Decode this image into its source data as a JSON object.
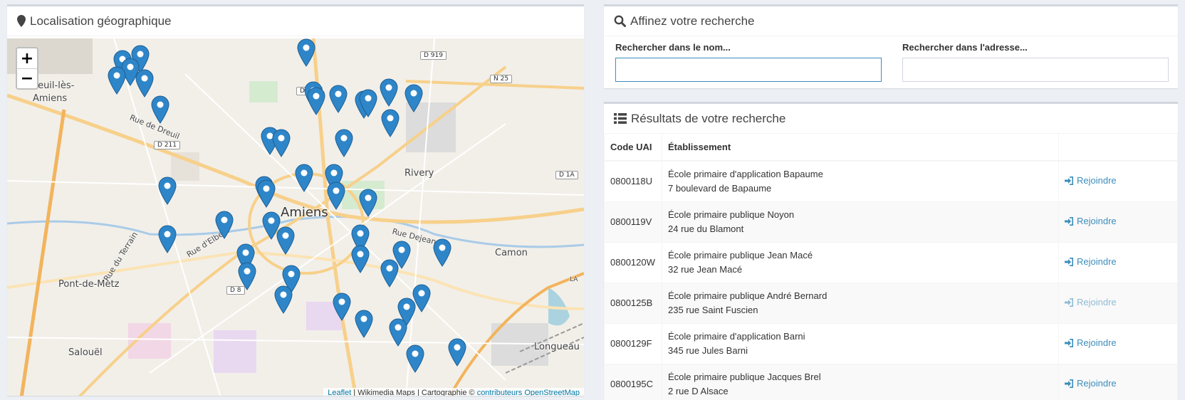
{
  "map_panel": {
    "title": "Localisation géographique",
    "icon": "map-marker-icon"
  },
  "map": {
    "zoom_in": "+",
    "zoom_out": "−",
    "attribution": {
      "leaflet": "Leaflet",
      "middle": " | Wikimedia Maps | Cartographie © ",
      "osm": "contributeurs OpenStreetMap"
    },
    "labels": {
      "amiens": "Amiens",
      "rivery": "Rivery",
      "camon": "Camon",
      "dreuil1": "Dreuil-lès-",
      "dreuil2": "Amiens",
      "pont_de_metz": "Pont-de-Metz",
      "saloul": "Salouël",
      "longueau": "Longueau",
      "rue_dreuil": "Rue de Dreuil",
      "rue_dejean": "Rue Dejean",
      "rue_elbeuf": "Rue d'Elbeuf",
      "rue_terrain": "Rue du Terrain",
      "la": "LA"
    },
    "road_badges": {
      "d919": "D 919",
      "n25": "N 25",
      "d933": "D 933",
      "d211": "D 211",
      "d1a": "D 1A",
      "d8": "D 8"
    },
    "marker_color": "#2e86c9"
  },
  "search_panel": {
    "title": "Affinez votre recherche",
    "icon": "search-icon",
    "name_label": "Rechercher dans le nom...",
    "name_value": "",
    "address_label": "Rechercher dans l'adresse...",
    "address_value": ""
  },
  "results_panel": {
    "title": "Résultats de votre recherche",
    "icon": "list-icon",
    "columns": {
      "code": "Code UAI",
      "etab": "Établissement",
      "action": ""
    },
    "action_label": "Rejoindre",
    "rows": [
      {
        "code": "0800118U",
        "name": "École primaire d'application Bapaume",
        "address": "7 boulevard de Bapaume"
      },
      {
        "code": "0800119V",
        "name": "École primaire publique Noyon",
        "address": "24 rue du Blamont"
      },
      {
        "code": "0800120W",
        "name": "École primaire publique Jean Macé",
        "address": "32 rue Jean Macé"
      },
      {
        "code": "0800125B",
        "name": "École primaire publique André Bernard",
        "address": "235 rue Saint Fuscien"
      },
      {
        "code": "0800129F",
        "name": "École primaire d'application Barni",
        "address": "345 rue Jules Barni"
      },
      {
        "code": "0800195C",
        "name": "École primaire publique Jacques Brel",
        "address": "2 rue D Alsace"
      }
    ]
  }
}
